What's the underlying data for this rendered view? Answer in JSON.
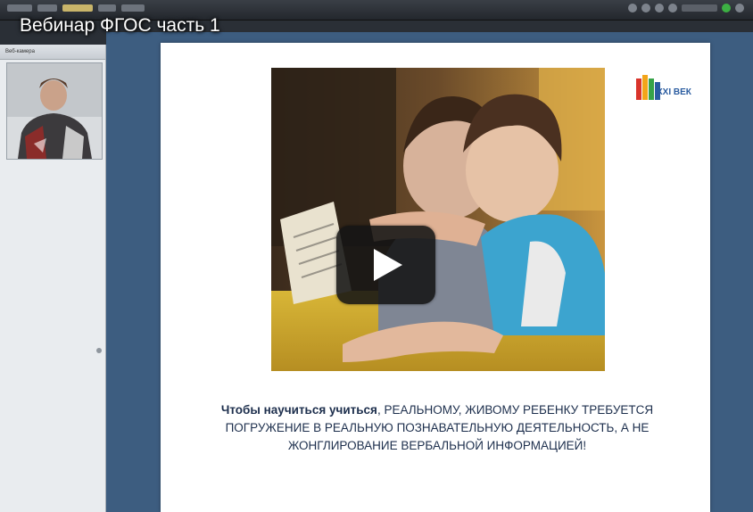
{
  "video": {
    "title": "Вебинар ФГОС часть 1"
  },
  "left_panel": {
    "header_label": "Веб-камера"
  },
  "slide": {
    "logo_text": "XXI ВЕК",
    "caption_bold": "Чтобы научиться учиться",
    "caption_rest": ", РЕАЛЬНОМУ, ЖИВОМУ РЕБЕНКУ  ТРЕБУЕТСЯ ПОГРУЖЕНИЕ В РЕАЛЬНУЮ ПОЗНАВАТЕЛЬНУЮ ДЕЯТЕЛЬНОСТЬ, А НЕ ЖОНГЛИРОВАНИЕ ВЕРБАЛЬНОЙ ИНФОРМАЦИЕЙ!"
  },
  "colors": {
    "stage_background": "#3d5d80",
    "caption_text": "#1d2f4d",
    "logo_accent": "#2a5ca0"
  },
  "icons": {
    "play": "play-triangle-icon"
  }
}
